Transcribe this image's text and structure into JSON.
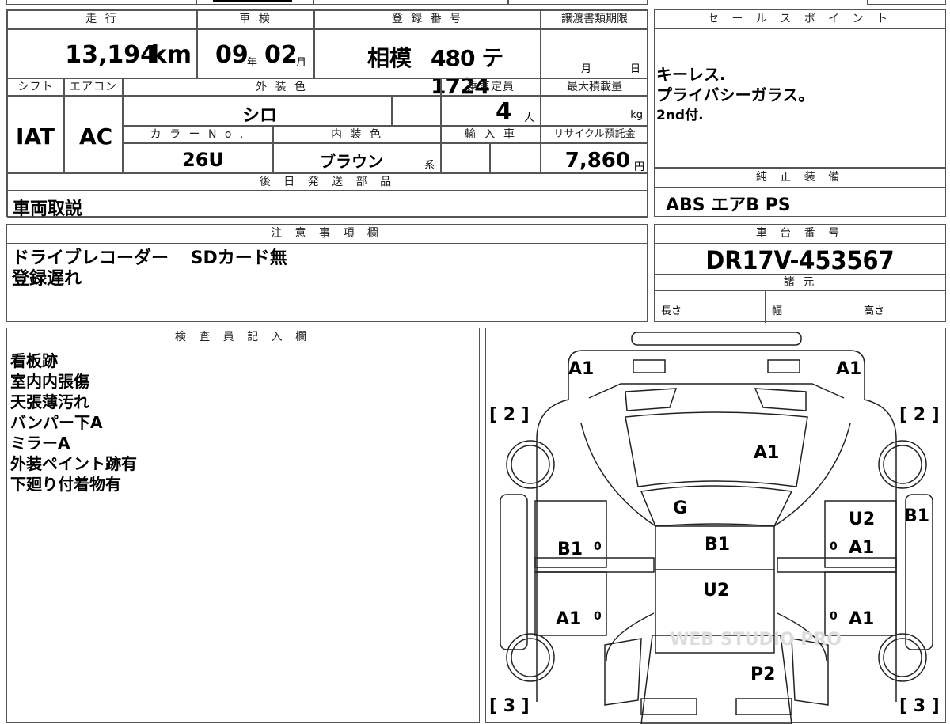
{
  "top_strip": {},
  "table": {
    "mileage_label": "走 行",
    "mileage_value": "13,194",
    "mileage_unit": "km",
    "inspection_label": "車 検",
    "inspection_year": "09",
    "inspection_year_unit": "年",
    "inspection_month": "02",
    "inspection_month_unit": "月",
    "plate_label": "登 録 番 号",
    "plate_region": "相模",
    "plate_number": "480 テ 1724",
    "transfer_label": "譲渡書類期限",
    "transfer_month_unit": "月",
    "transfer_day_unit": "日",
    "shift_label": "シフト",
    "shift_value": "IAT",
    "ac_label": "エアコン",
    "ac_value": "AC",
    "exterior_label": "外 装 色",
    "exterior_value": "シロ",
    "capacity_label": "乗車定員",
    "capacity_value": "4",
    "capacity_unit": "人",
    "maxload_label": "最大積載量",
    "maxload_unit": "kg",
    "color_no_label": "カ ラ ー N o .",
    "color_no_value": "26U",
    "interior_label": "内 装 色",
    "interior_value": "ブラウン",
    "interior_suffix": "系",
    "import_label": "輸 入 車",
    "recycle_label": "リサイクル預託金",
    "recycle_value": "7,860",
    "recycle_unit": "円",
    "later_parts_label": "後 日 発 送 部 品",
    "later_parts_value": "車両取説"
  },
  "sales_points": {
    "label": "セ ー ル ス ポ イ ン ト",
    "lines": [
      "キーレス.",
      "プライバシーガラス。",
      "2nd付."
    ]
  },
  "genuine_equipment": {
    "label": "純 正 装 備",
    "value": "ABS エアB PS"
  },
  "notes": {
    "label": "注 意 事 項 欄",
    "lines": [
      "ドライブレコーダー SDカード無",
      "登録遅れ"
    ]
  },
  "chassis": {
    "label": "車 台 番 号",
    "value": "DR17V-453567",
    "specs_label": "諸 元",
    "length_label": "長さ",
    "width_label": "幅",
    "height_label": "高さ"
  },
  "inspector": {
    "label": "検 査 員 記 入 欄",
    "lines": [
      "看板跡",
      "室内内張傷",
      "天張薄汚れ",
      "バンパー下A",
      "ミラーA",
      "外装ペイント跡有",
      "下廻り付着物有"
    ]
  },
  "diagram": {
    "marks": {
      "front_left_a1": "A1",
      "front_right_a1": "A1",
      "bracket_2_left": "[ 2 ]",
      "bracket_2_right": "[ 2 ]",
      "hood_a1": "A1",
      "windshield_g": "G",
      "roof_b1": "B1",
      "roof_u2": "U2",
      "left_front_door_b1": "B1",
      "left_rear_door_a1": "A1",
      "right_front_door_u2": "U2",
      "right_front_door_a1": "A1",
      "right_side_b1": "B1",
      "right_rear_door_a1": "A1",
      "rear_p2": "P2",
      "bracket_3_left": "[ 3 ]",
      "bracket_3_right": "[ 3 ]",
      "zero": "0"
    },
    "watermark": "WEB STUDIO PRO"
  }
}
